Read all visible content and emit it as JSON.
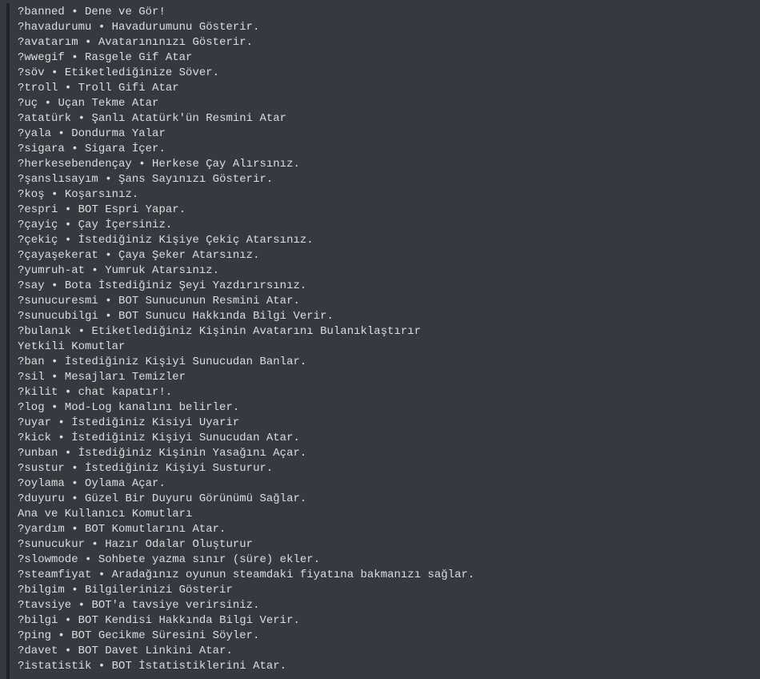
{
  "prefix": "?",
  "separator": " • ",
  "entries": [
    {
      "type": "cmd",
      "cmd": "banned",
      "desc": "Dene ve Gör!"
    },
    {
      "type": "cmd",
      "cmd": "havadurumu",
      "desc": "Havadurumunu Gösterir."
    },
    {
      "type": "cmd",
      "cmd": "avatarım",
      "desc": "Avatarınınızı Gösterir."
    },
    {
      "type": "cmd",
      "cmd": "wwegif",
      "desc": "Rasgele Gif Atar"
    },
    {
      "type": "cmd",
      "cmd": "söv",
      "desc": "Etiketlediğinize Söver."
    },
    {
      "type": "cmd",
      "cmd": "troll",
      "desc": "Troll Gifi Atar"
    },
    {
      "type": "cmd",
      "cmd": "uç",
      "desc": "Uçan Tekme Atar"
    },
    {
      "type": "cmd",
      "cmd": "atatürk",
      "desc": "Şanlı Atatürk'ün Resmini Atar"
    },
    {
      "type": "cmd",
      "cmd": "yala",
      "desc": "Dondurma Yalar"
    },
    {
      "type": "cmd",
      "cmd": "sigara",
      "desc": "Sigara İçer."
    },
    {
      "type": "cmd",
      "cmd": "herkesebendençay",
      "desc": "Herkese Çay Alırsınız."
    },
    {
      "type": "cmd",
      "cmd": "şanslısayım",
      "desc": "Şans Sayınızı Gösterir."
    },
    {
      "type": "cmd",
      "cmd": "koş",
      "desc": "Koşarsınız."
    },
    {
      "type": "cmd",
      "cmd": "espri",
      "desc": "BOT Espri Yapar."
    },
    {
      "type": "cmd",
      "cmd": "çayiç",
      "desc": "Çay İçersiniz."
    },
    {
      "type": "cmd",
      "cmd": "çekiç",
      "desc": "İstediğiniz Kişiye Çekiç Atarsınız."
    },
    {
      "type": "cmd",
      "cmd": "çayaşekerat",
      "desc": "Çaya Şeker Atarsınız."
    },
    {
      "type": "cmd",
      "cmd": "yumruh-at",
      "desc": "Yumruk Atarsınız."
    },
    {
      "type": "cmd",
      "cmd": "say",
      "desc": "Bota İstediğiniz Şeyi Yazdırırsınız."
    },
    {
      "type": "cmd",
      "cmd": "sunucuresmi",
      "desc": "BOT Sunucunun Resmini Atar."
    },
    {
      "type": "cmd",
      "cmd": "sunucubilgi",
      "desc": "BOT Sunucu Hakkında Bilgi Verir."
    },
    {
      "type": "cmd",
      "cmd": "bulanık",
      "desc": "Etiketlediğiniz Kişinin Avatarını Bulanıklaştırır"
    },
    {
      "type": "section",
      "text": "Yetkili Komutlar"
    },
    {
      "type": "cmd",
      "cmd": "ban",
      "desc": "İstediğiniz Kişiyi Sunucudan Banlar."
    },
    {
      "type": "cmd",
      "cmd": "sil",
      "desc": "Mesajları Temizler"
    },
    {
      "type": "cmd",
      "cmd": "kilit",
      "desc": "chat kapatır!."
    },
    {
      "type": "cmd",
      "cmd": "log",
      "desc": "Mod-Log kanalını belirler."
    },
    {
      "type": "cmd",
      "cmd": "uyar",
      "desc": "İstediğiniz Kisiyi Uyarir"
    },
    {
      "type": "cmd",
      "cmd": "kick",
      "desc": "İstediğiniz Kişiyi Sunucudan Atar."
    },
    {
      "type": "cmd",
      "cmd": "unban",
      "desc": "İstediğiniz Kişinin Yasağını Açar."
    },
    {
      "type": "cmd",
      "cmd": "sustur",
      "desc": "İstediğiniz Kişiyi Susturur."
    },
    {
      "type": "cmd",
      "cmd": "oylama",
      "desc": "Oylama Açar."
    },
    {
      "type": "cmd",
      "cmd": "duyuru",
      "desc": "Güzel Bir Duyuru Görünümü Sağlar."
    },
    {
      "type": "section",
      "text": "Ana ve Kullanıcı Komutları"
    },
    {
      "type": "cmd",
      "cmd": "yardım",
      "desc": "BOT Komutlarını Atar."
    },
    {
      "type": "cmd",
      "cmd": "sunucukur",
      "desc": "Hazır Odalar Oluşturur"
    },
    {
      "type": "cmd",
      "cmd": "slowmode",
      "desc": "Sohbete yazma sınır (süre) ekler."
    },
    {
      "type": "cmd",
      "cmd": "steamfiyat",
      "desc": "Aradağınız oyunun steamdaki fiyatına bakmanızı sağlar."
    },
    {
      "type": "cmd",
      "cmd": "bilgim",
      "desc": "Bilgilerinizi Gösterir"
    },
    {
      "type": "cmd",
      "cmd": "tavsiye",
      "desc": "BOT'a tavsiye verirsiniz."
    },
    {
      "type": "cmd",
      "cmd": "bilgi",
      "desc": "BOT Kendisi Hakkında Bilgi Verir."
    },
    {
      "type": "cmd",
      "cmd": "ping",
      "desc": "BOT Gecikme Süresini Söyler."
    },
    {
      "type": "cmd",
      "cmd": "davet",
      "desc": "BOT Davet Linkini Atar."
    },
    {
      "type": "cmd",
      "cmd": "istatistik",
      "desc": "BOT İstatistiklerini Atar."
    }
  ]
}
